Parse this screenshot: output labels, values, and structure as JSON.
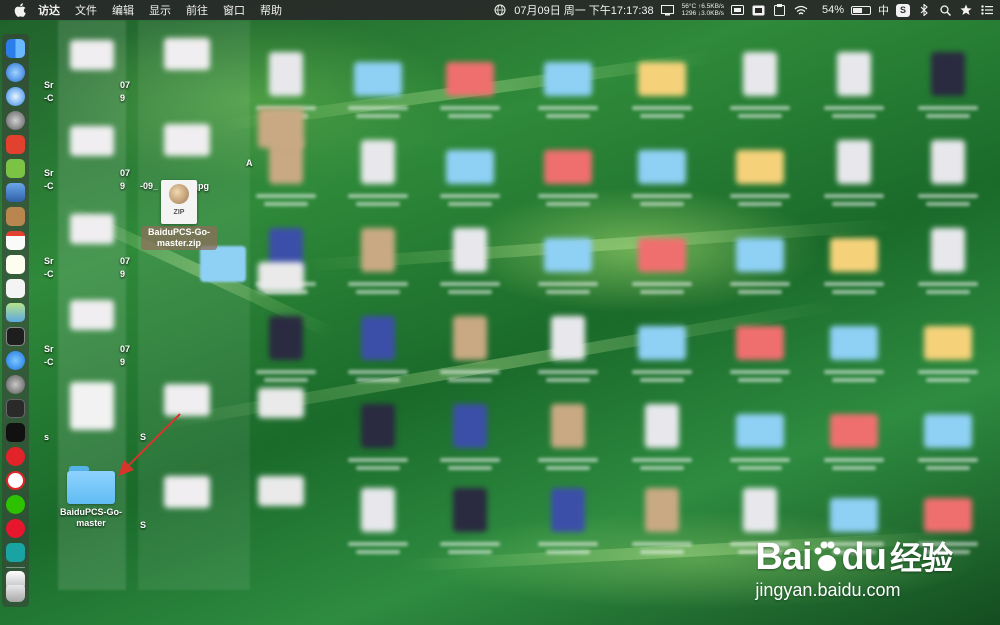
{
  "menubar": {
    "app_name": "访达",
    "menus": [
      "文件",
      "编辑",
      "显示",
      "前往",
      "窗口",
      "帮助"
    ],
    "datetime": "07月09日 周一 下午17:17:38",
    "stats_line1": "56°C ↑6.5KB/s",
    "stats_line2": "1296 ↓3.0KB/s",
    "battery_percent": "54%",
    "battery_level": 0.54,
    "ime_label": "中",
    "ime_badge": "S"
  },
  "desktop": {
    "folder_label": "BaiduPCS-Go-master",
    "zip_label": "BaiduPCS-Go-master.zip",
    "zip_badge": "ZIP",
    "partial_labels": {
      "sr1_line1": "Sr",
      "sr1_line2": "-C",
      "sr1_right": "07",
      "sr1_right2": "9",
      "sr2_line1": "Sr",
      "sr2_line2": "-C",
      "sr2_right": "07",
      "sr2_right2": "9",
      "sr3_line1": "Sr",
      "sr3_line2": "-C",
      "sr3_right": "07",
      "sr3_right2": "9",
      "sr4_line1": "Sr",
      "sr4_line2": "-C",
      "sr4_right": "07",
      "sr4_right2": "9",
      "jpg": "-09_          25.jpg",
      "partial_a": "A",
      "partial_s": "S",
      "partial_s2": "S",
      "partial_s3": "s"
    }
  },
  "watermark": {
    "main": "Bai",
    "paw": "du",
    "cn": "经验",
    "url": "jingyan.baidu.com"
  },
  "colors": {
    "folder": "#60bcf2",
    "menubar": "#282828",
    "arrow": "#d8352a"
  }
}
